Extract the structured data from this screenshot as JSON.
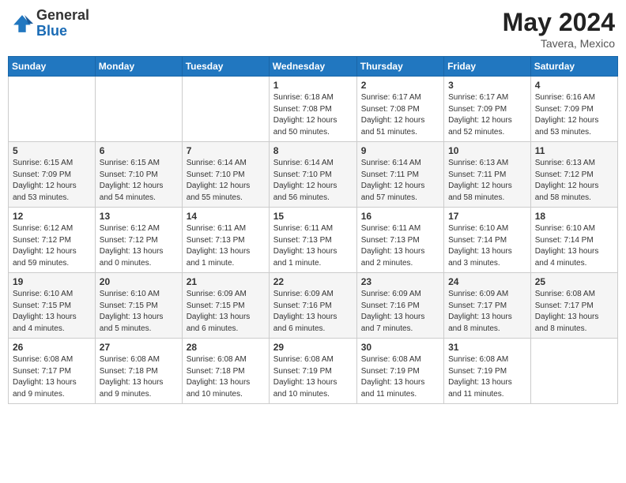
{
  "header": {
    "logo_general": "General",
    "logo_blue": "Blue",
    "month_year": "May 2024",
    "location": "Tavera, Mexico"
  },
  "weekdays": [
    "Sunday",
    "Monday",
    "Tuesday",
    "Wednesday",
    "Thursday",
    "Friday",
    "Saturday"
  ],
  "weeks": [
    [
      {
        "day": "",
        "info": ""
      },
      {
        "day": "",
        "info": ""
      },
      {
        "day": "",
        "info": ""
      },
      {
        "day": "1",
        "info": "Sunrise: 6:18 AM\nSunset: 7:08 PM\nDaylight: 12 hours\nand 50 minutes."
      },
      {
        "day": "2",
        "info": "Sunrise: 6:17 AM\nSunset: 7:08 PM\nDaylight: 12 hours\nand 51 minutes."
      },
      {
        "day": "3",
        "info": "Sunrise: 6:17 AM\nSunset: 7:09 PM\nDaylight: 12 hours\nand 52 minutes."
      },
      {
        "day": "4",
        "info": "Sunrise: 6:16 AM\nSunset: 7:09 PM\nDaylight: 12 hours\nand 53 minutes."
      }
    ],
    [
      {
        "day": "5",
        "info": "Sunrise: 6:15 AM\nSunset: 7:09 PM\nDaylight: 12 hours\nand 53 minutes."
      },
      {
        "day": "6",
        "info": "Sunrise: 6:15 AM\nSunset: 7:10 PM\nDaylight: 12 hours\nand 54 minutes."
      },
      {
        "day": "7",
        "info": "Sunrise: 6:14 AM\nSunset: 7:10 PM\nDaylight: 12 hours\nand 55 minutes."
      },
      {
        "day": "8",
        "info": "Sunrise: 6:14 AM\nSunset: 7:10 PM\nDaylight: 12 hours\nand 56 minutes."
      },
      {
        "day": "9",
        "info": "Sunrise: 6:14 AM\nSunset: 7:11 PM\nDaylight: 12 hours\nand 57 minutes."
      },
      {
        "day": "10",
        "info": "Sunrise: 6:13 AM\nSunset: 7:11 PM\nDaylight: 12 hours\nand 58 minutes."
      },
      {
        "day": "11",
        "info": "Sunrise: 6:13 AM\nSunset: 7:12 PM\nDaylight: 12 hours\nand 58 minutes."
      }
    ],
    [
      {
        "day": "12",
        "info": "Sunrise: 6:12 AM\nSunset: 7:12 PM\nDaylight: 12 hours\nand 59 minutes."
      },
      {
        "day": "13",
        "info": "Sunrise: 6:12 AM\nSunset: 7:12 PM\nDaylight: 13 hours\nand 0 minutes."
      },
      {
        "day": "14",
        "info": "Sunrise: 6:11 AM\nSunset: 7:13 PM\nDaylight: 13 hours\nand 1 minute."
      },
      {
        "day": "15",
        "info": "Sunrise: 6:11 AM\nSunset: 7:13 PM\nDaylight: 13 hours\nand 1 minute."
      },
      {
        "day": "16",
        "info": "Sunrise: 6:11 AM\nSunset: 7:13 PM\nDaylight: 13 hours\nand 2 minutes."
      },
      {
        "day": "17",
        "info": "Sunrise: 6:10 AM\nSunset: 7:14 PM\nDaylight: 13 hours\nand 3 minutes."
      },
      {
        "day": "18",
        "info": "Sunrise: 6:10 AM\nSunset: 7:14 PM\nDaylight: 13 hours\nand 4 minutes."
      }
    ],
    [
      {
        "day": "19",
        "info": "Sunrise: 6:10 AM\nSunset: 7:15 PM\nDaylight: 13 hours\nand 4 minutes."
      },
      {
        "day": "20",
        "info": "Sunrise: 6:10 AM\nSunset: 7:15 PM\nDaylight: 13 hours\nand 5 minutes."
      },
      {
        "day": "21",
        "info": "Sunrise: 6:09 AM\nSunset: 7:15 PM\nDaylight: 13 hours\nand 6 minutes."
      },
      {
        "day": "22",
        "info": "Sunrise: 6:09 AM\nSunset: 7:16 PM\nDaylight: 13 hours\nand 6 minutes."
      },
      {
        "day": "23",
        "info": "Sunrise: 6:09 AM\nSunset: 7:16 PM\nDaylight: 13 hours\nand 7 minutes."
      },
      {
        "day": "24",
        "info": "Sunrise: 6:09 AM\nSunset: 7:17 PM\nDaylight: 13 hours\nand 8 minutes."
      },
      {
        "day": "25",
        "info": "Sunrise: 6:08 AM\nSunset: 7:17 PM\nDaylight: 13 hours\nand 8 minutes."
      }
    ],
    [
      {
        "day": "26",
        "info": "Sunrise: 6:08 AM\nSunset: 7:17 PM\nDaylight: 13 hours\nand 9 minutes."
      },
      {
        "day": "27",
        "info": "Sunrise: 6:08 AM\nSunset: 7:18 PM\nDaylight: 13 hours\nand 9 minutes."
      },
      {
        "day": "28",
        "info": "Sunrise: 6:08 AM\nSunset: 7:18 PM\nDaylight: 13 hours\nand 10 minutes."
      },
      {
        "day": "29",
        "info": "Sunrise: 6:08 AM\nSunset: 7:19 PM\nDaylight: 13 hours\nand 10 minutes."
      },
      {
        "day": "30",
        "info": "Sunrise: 6:08 AM\nSunset: 7:19 PM\nDaylight: 13 hours\nand 11 minutes."
      },
      {
        "day": "31",
        "info": "Sunrise: 6:08 AM\nSunset: 7:19 PM\nDaylight: 13 hours\nand 11 minutes."
      },
      {
        "day": "",
        "info": ""
      }
    ]
  ]
}
